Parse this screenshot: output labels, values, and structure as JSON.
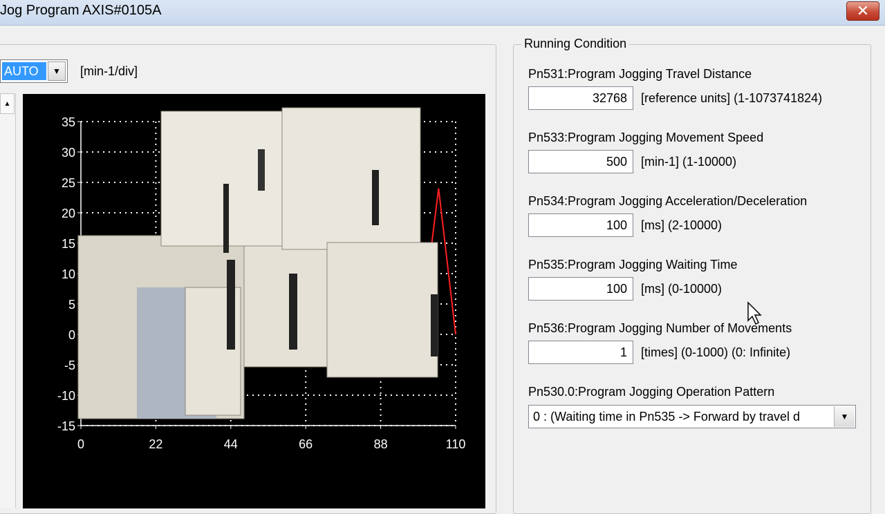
{
  "window": {
    "title": "Jog Program AXIS#0105A",
    "close_glyph": "✕"
  },
  "graph": {
    "scale_value": "AUTO",
    "scale_arrow": "▼",
    "unit": "[min-1/div]",
    "scroll_up": "▲"
  },
  "chart_data": {
    "type": "line",
    "x_ticks": [
      "0",
      "22",
      "44",
      "66",
      "88",
      "110"
    ],
    "y_ticks": [
      "35",
      "30",
      "25",
      "20",
      "15",
      "10",
      "5",
      "0",
      "-5",
      "-10",
      "-15"
    ],
    "xlim": [
      0,
      110
    ],
    "ylim": [
      -15,
      35
    ],
    "grid": true,
    "background": "#000000",
    "grid_color": "#ffffff",
    "series": [
      {
        "color": "#ff2020",
        "x": [
          61,
          94,
          103,
          105,
          110
        ],
        "y": [
          0,
          0,
          15,
          24,
          0
        ]
      }
    ]
  },
  "running_condition": {
    "legend": "Running Condition",
    "fields": [
      {
        "label": "Pn531:Program Jogging Travel Distance",
        "value": "32768",
        "range": "[reference units] (1-1073741824)"
      },
      {
        "label": "Pn533:Program Jogging Movement Speed",
        "value": "500",
        "range": "[min-1] (1-10000)"
      },
      {
        "label": "Pn534:Program Jogging Acceleration/Deceleration",
        "value": "100",
        "range": "[ms] (2-10000)"
      },
      {
        "label": "Pn535:Program Jogging Waiting Time",
        "value": "100",
        "range": "[ms] (0-10000)"
      },
      {
        "label": "Pn536:Program Jogging Number of Movements",
        "value": "1",
        "range": "[times] (0-1000) (0: Infinite)"
      }
    ],
    "pattern": {
      "label": "Pn530.0:Program Jogging Operation Pattern",
      "value": "0 : (Waiting time in Pn535 -> Forward by travel d",
      "arrow": "▼"
    }
  },
  "colors": {
    "titlebar": "#c9d9ee",
    "close_button": "#c84c3a",
    "selection": "#3399ff",
    "chart_line": "#ff2020"
  },
  "icons": {
    "close": "close-icon",
    "dropdown": "chevron-down-icon",
    "scroll_up": "scroll-up-icon",
    "cursor": "mouse-pointer-icon"
  }
}
